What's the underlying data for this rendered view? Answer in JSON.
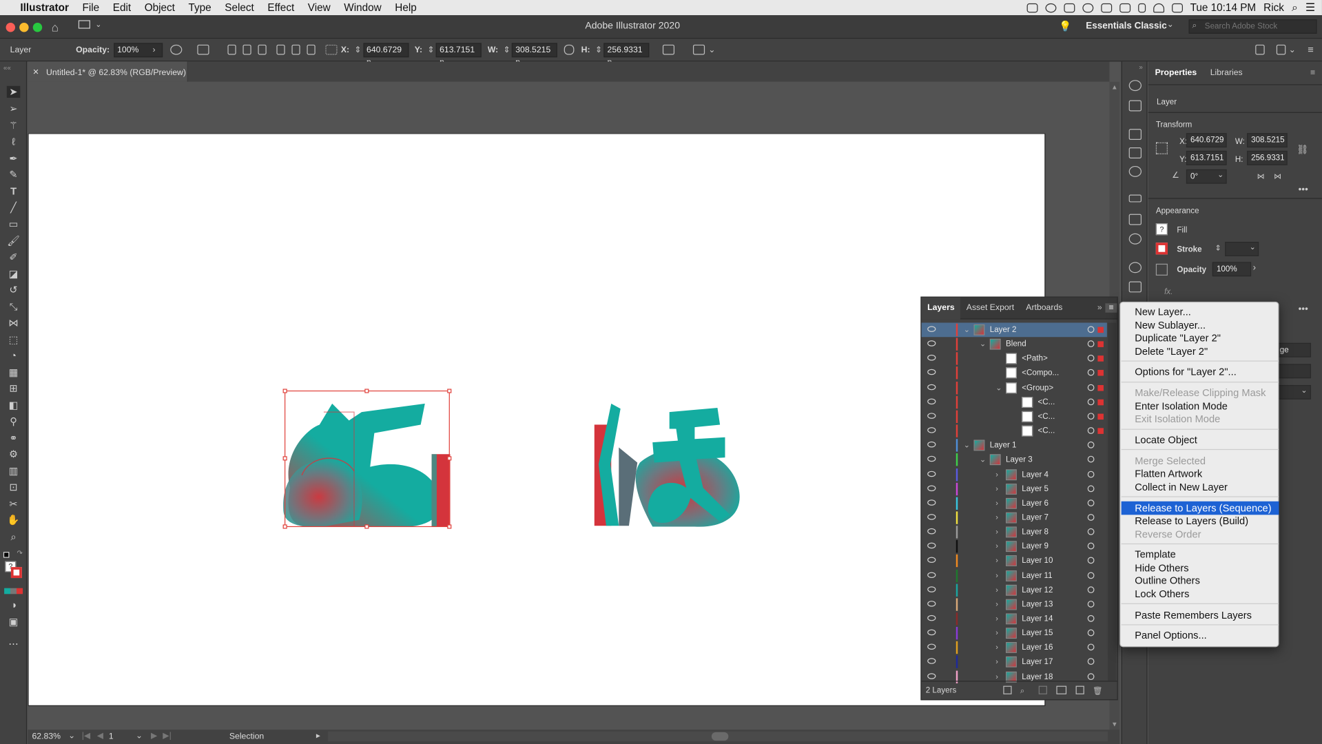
{
  "menubar": {
    "apple": "",
    "app": "Illustrator",
    "items": [
      "File",
      "Edit",
      "Object",
      "Type",
      "Select",
      "Effect",
      "View",
      "Window",
      "Help"
    ],
    "clock": "Tue 10:14 PM",
    "user": "Rick"
  },
  "appbar": {
    "title": "Adobe Illustrator 2020",
    "workspace": "Essentials Classic",
    "search_placeholder": "Search Adobe Stock"
  },
  "control_bar": {
    "selection_label": "Layer",
    "opacity_label": "Opacity:",
    "opacity_value": "100%",
    "x_label": "X:",
    "x_value": "640.6729 p",
    "y_label": "Y:",
    "y_value": "613.7151 p",
    "w_label": "W:",
    "w_value": "308.5215 p",
    "h_label": "H:",
    "h_value": "256.9331 p"
  },
  "document": {
    "close": "×",
    "tab_title": "Untitled-1* @ 62.83% (RGB/Preview)"
  },
  "statusbar": {
    "zoom": "62.83%",
    "artboard": "1",
    "tool": "Selection"
  },
  "properties": {
    "tabs": [
      "Properties",
      "Libraries"
    ],
    "selection_type": "Layer",
    "transform_title": "Transform",
    "x_label": "X:",
    "x_value": "640.6729",
    "w_label": "W:",
    "w_value": "308.5215",
    "y_label": "Y:",
    "y_value": "613.7151",
    "h_label": "H:",
    "h_value": "256.9331",
    "angle_value": "0°",
    "appearance_title": "Appearance",
    "fill_label": "Fill",
    "stroke_label": "Stroke",
    "opacity_label": "Opacity",
    "opacity_value": "100%",
    "fx_label": "fx.",
    "partial_text": "ge"
  },
  "layers_panel": {
    "tabs": [
      "Layers",
      "Asset Export",
      "Artboards"
    ],
    "rows": [
      {
        "name": "Layer 2",
        "color": "#e0403a"
      },
      {
        "name": "Blend",
        "color": "#e0403a"
      },
      {
        "name": "<Path>",
        "color": "#e0403a"
      },
      {
        "name": "<Compo...",
        "color": "#e0403a"
      },
      {
        "name": "<Group>",
        "color": "#e0403a"
      },
      {
        "name": "<C...",
        "color": "#e0403a"
      },
      {
        "name": "<C...",
        "color": "#e0403a"
      },
      {
        "name": "<C...",
        "color": "#e0403a"
      },
      {
        "name": "Layer 1",
        "color": "#4f8fd8"
      },
      {
        "name": "Layer 3",
        "color": "#3fcf4a"
      },
      {
        "name": "Layer 4",
        "color": "#5a5ae0"
      },
      {
        "name": "Layer 5",
        "color": "#c948d8"
      },
      {
        "name": "Layer 6",
        "color": "#38c6e0"
      },
      {
        "name": "Layer 7",
        "color": "#f0e040"
      },
      {
        "name": "Layer 8",
        "color": "#9a9a9a"
      },
      {
        "name": "Layer 9",
        "color": "#111111"
      },
      {
        "name": "Layer 10",
        "color": "#f08a20"
      },
      {
        "name": "Layer 11",
        "color": "#1e7a2e"
      },
      {
        "name": "Layer 12",
        "color": "#1aa5a0"
      },
      {
        "name": "Layer 13",
        "color": "#d8a878"
      },
      {
        "name": "Layer 14",
        "color": "#8a2a2a"
      },
      {
        "name": "Layer 15",
        "color": "#8a3ad8"
      },
      {
        "name": "Layer 16",
        "color": "#e0a020"
      },
      {
        "name": "Layer 17",
        "color": "#1e2a9a"
      },
      {
        "name": "Layer 18",
        "color": "#f0a0c8"
      }
    ],
    "footer_count": "2 Layers"
  },
  "context_menu": {
    "groups": [
      [
        "New Layer...",
        "New Sublayer...",
        "Duplicate \"Layer 2\"",
        "Delete \"Layer 2\""
      ],
      [
        "Options for \"Layer 2\"..."
      ],
      [
        "Make/Release Clipping Mask",
        "Enter Isolation Mode",
        "Exit Isolation Mode"
      ],
      [
        "Locate Object"
      ],
      [
        "Merge Selected",
        "Flatten Artwork",
        "Collect in New Layer"
      ],
      [
        "Release to Layers (Sequence)",
        "Release to Layers (Build)",
        "Reverse Order"
      ],
      [
        "Template",
        "Hide Others",
        "Outline Others",
        "Lock Others"
      ],
      [
        "Paste Remembers Layers"
      ],
      [
        "Panel Options..."
      ]
    ],
    "disabled": [
      "Make/Release Clipping Mask",
      "Exit Isolation Mode",
      "Merge Selected",
      "Reverse Order"
    ],
    "highlighted": "Release to Layers (Sequence)"
  },
  "colors": {
    "teal": "#14aca0",
    "red": "#d4343c",
    "highlight": "#1d62d4",
    "selection_row": "#4d6d90"
  }
}
